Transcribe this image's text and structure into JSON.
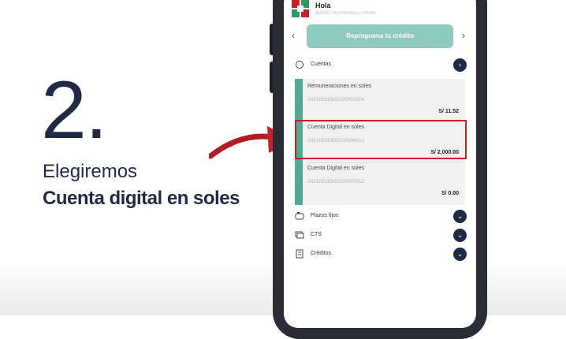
{
  "instruction": {
    "step_number": "2.",
    "line1": "Elegiremos",
    "line2": "Cuenta digital en soles"
  },
  "app": {
    "greeting": "Hola",
    "user_id": "MARIO HERNANDEZ PAAN",
    "banner_button": "Reprograma tu crédito",
    "nav_prev": "‹",
    "nav_next": "›"
  },
  "sections": {
    "cuentas": "Cuentas",
    "plazos_fijos": "Plazos fijos",
    "cts": "CTS",
    "creditos": "Créditos"
  },
  "accounts": [
    {
      "name": "Remuneraciones en soles",
      "number": "00210518302100001004",
      "balance": "S/ 11.52"
    },
    {
      "name": "Cuenta Digital en soles",
      "number": "00210518302100006012",
      "balance": "S/ 2,000.00"
    },
    {
      "name": "Cuenta Digital en soles",
      "number": "00210518302100007012",
      "balance": "S/ 0.00"
    }
  ],
  "colors": {
    "accent": "#52a994",
    "banner": "#8fcbbe",
    "highlight": "#c8202a",
    "navy": "#1f2a44"
  }
}
